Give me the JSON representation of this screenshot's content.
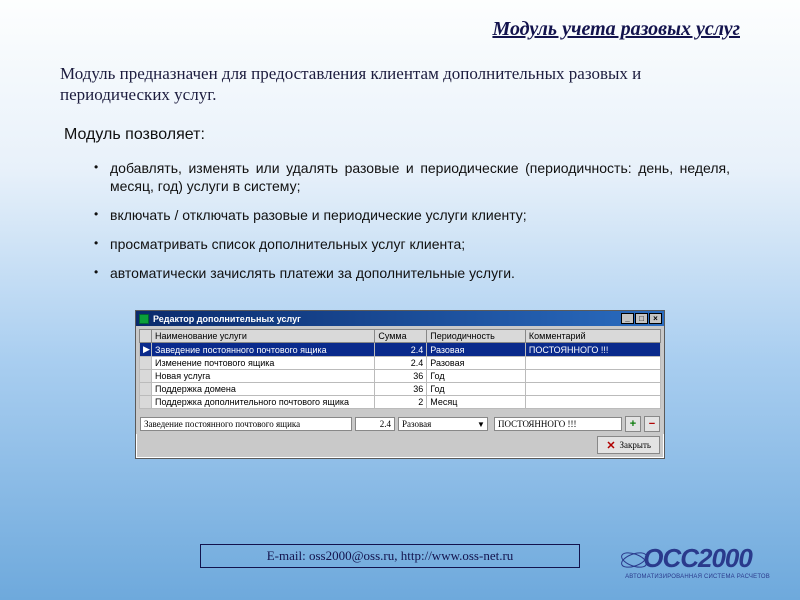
{
  "page": {
    "title": "Модуль учета разовых услуг",
    "lead": "Модуль предназначен для предоставления клиентам дополнительных разовых и периодических услуг.",
    "allow_label": "Модуль позволяет:",
    "features": [
      "добавлять, изменять или удалять разовые и периодические (периодичность: день, неделя, месяц, год) услуги в систему;",
      "включать / отключать разовые и периодические услуги клиенту;",
      "просматривать список дополнительных услуг клиента;",
      "автоматически зачислять платежи за дополнительные услуги."
    ]
  },
  "editor": {
    "title": "Редактор дополнительных услуг",
    "columns": {
      "name": "Наименование услуги",
      "sum": "Сумма",
      "period": "Периодичность",
      "comment": "Комментарий"
    },
    "rows": [
      {
        "name": "Заведение постоянного почтового ящика",
        "sum": "2.4",
        "period": "Разовая",
        "comment": "ПОСТОЯННОГО !!!",
        "selected": true
      },
      {
        "name": "Изменение почтового ящика",
        "sum": "2.4",
        "period": "Разовая",
        "comment": ""
      },
      {
        "name": "Новая услуга",
        "sum": "36",
        "period": "Год",
        "comment": ""
      },
      {
        "name": "Поддержка домена",
        "sum": "36",
        "period": "Год",
        "comment": ""
      },
      {
        "name": "Поддержка дополнительного почтового ящика",
        "sum": "2",
        "period": "Месяц",
        "comment": ""
      }
    ],
    "detail": {
      "name": "Заведение постоянного почтового ящика",
      "sum": "2.4",
      "period": "Разовая",
      "comment": "ПОСТОЯННОГО !!!"
    },
    "buttons": {
      "add": "+",
      "remove": "−",
      "close": "Закрыть"
    },
    "winctl": {
      "min": "_",
      "max": "□",
      "close": "×"
    }
  },
  "footer": {
    "text": "E-mail: oss2000@oss.ru,  http://www.oss-net.ru"
  },
  "logo": {
    "brand": "OCC2000",
    "tag": "АВТОМАТИЗИРОВАННАЯ СИСТЕМА РАСЧЕТОВ"
  }
}
